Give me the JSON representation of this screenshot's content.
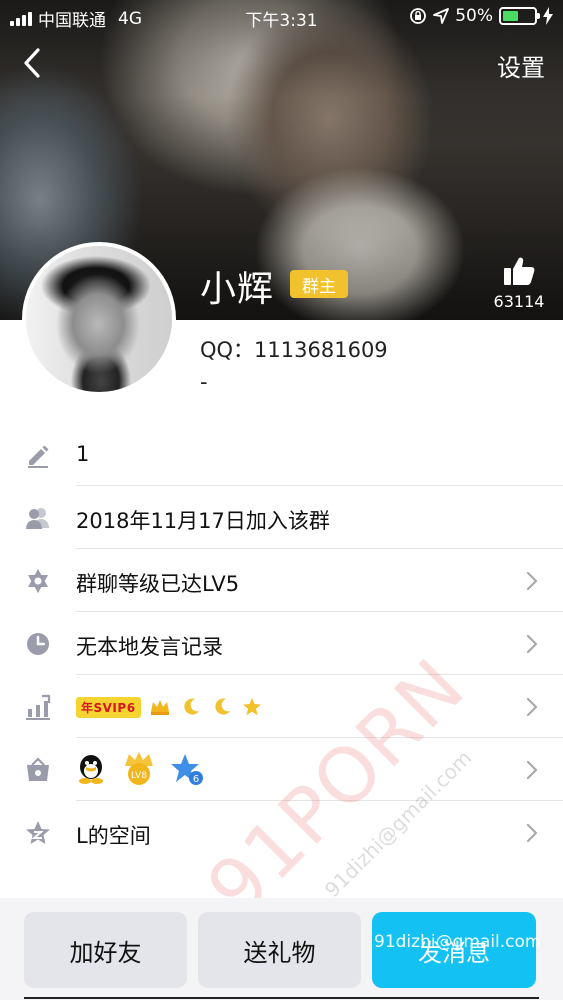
{
  "status_bar": {
    "carrier": "中国联通",
    "network": "4G",
    "time": "下午3:31",
    "battery_percent": "50%",
    "battery_level": 0.5
  },
  "nav": {
    "settings_label": "设置"
  },
  "profile": {
    "name": "小辉",
    "owner_badge": "群主",
    "likes": "63114",
    "qq_line": "QQ：1113681609",
    "signature": "-"
  },
  "info_rows": {
    "nickname_value": "1",
    "joined": "2018年11月17日加入该群",
    "level": "群聊等级已达LV5",
    "history": "无本地发言记录",
    "vip_badge": "年SVIP6",
    "space": "L的空间",
    "badges_text": "LV8",
    "badge_number": "6"
  },
  "watermark": {
    "big": "91PORN",
    "small": "91dizhi@gmail.com"
  },
  "bottom_buttons": {
    "add_friend": "加好友",
    "send_gift": "送礼物",
    "send_message": "发消息",
    "message_overlay": "91dizhi@gmail.com"
  },
  "colors": {
    "accent": "#13c2f3",
    "owner_badge": "#f2c12e",
    "battery": "#4cd964",
    "icon_gray": "#9a9cab"
  }
}
